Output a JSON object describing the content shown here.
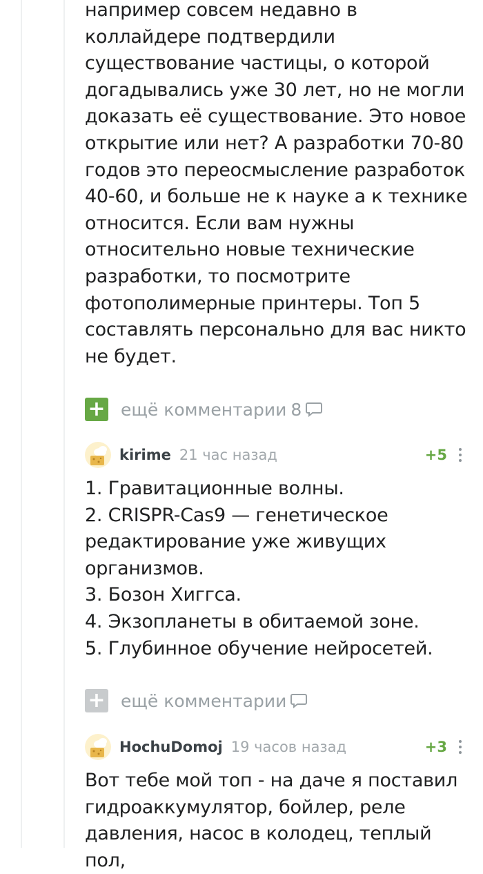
{
  "comment_top": {
    "text": "например совсем недавно в\nколлайдере подтвердили\nсуществование частицы, о которой\nдогадывались уже 30 лет, но не могли\nдоказать её существование. Это новое\nоткрытие или нет? А разработки 70-80\nгодов это переосмысление разработок\n40-60, и больше не к науке а к технике\nотносится. Если вам нужны\nотносительно новые технические\nразработки, то посмотрите\nфотополимерные принтеры. Топ 5\nсоставлять персонально для вас никто\nне будет."
  },
  "more_comments_1": {
    "label": "ещё комментарии",
    "count": "8",
    "icon": "speech-bubble-icon",
    "button_color": "#67a845"
  },
  "comment_kirime": {
    "username": "kirime",
    "time": "21 час назад",
    "rating": "+5",
    "text": "1. Гравитационные волны.\n2. CRISPR-Cas9 — генетическое\nредактирование уже живущих\nорганизмов.\n3. Бозон Хиггса.\n4. Экзопланеты в обитаемой зоне.\n5. Глубинное обучение нейросетей."
  },
  "more_comments_2": {
    "label": "ещё комментарии",
    "icon": "speech-bubble-icon",
    "button_color": "#c8cbcd"
  },
  "comment_hochudomoj": {
    "username": "HochuDomoj",
    "time": "19 часов назад",
    "rating": "+3",
    "text": "Вот тебе мой топ - на даче я поставил\nгидроаккумулятор, бойлер, реле\nдавления, насос в колодец, теплый пол,"
  },
  "colors": {
    "accent_green": "#67a845",
    "muted_text": "#9aa1a5",
    "thread_line": "#eef0f1"
  }
}
